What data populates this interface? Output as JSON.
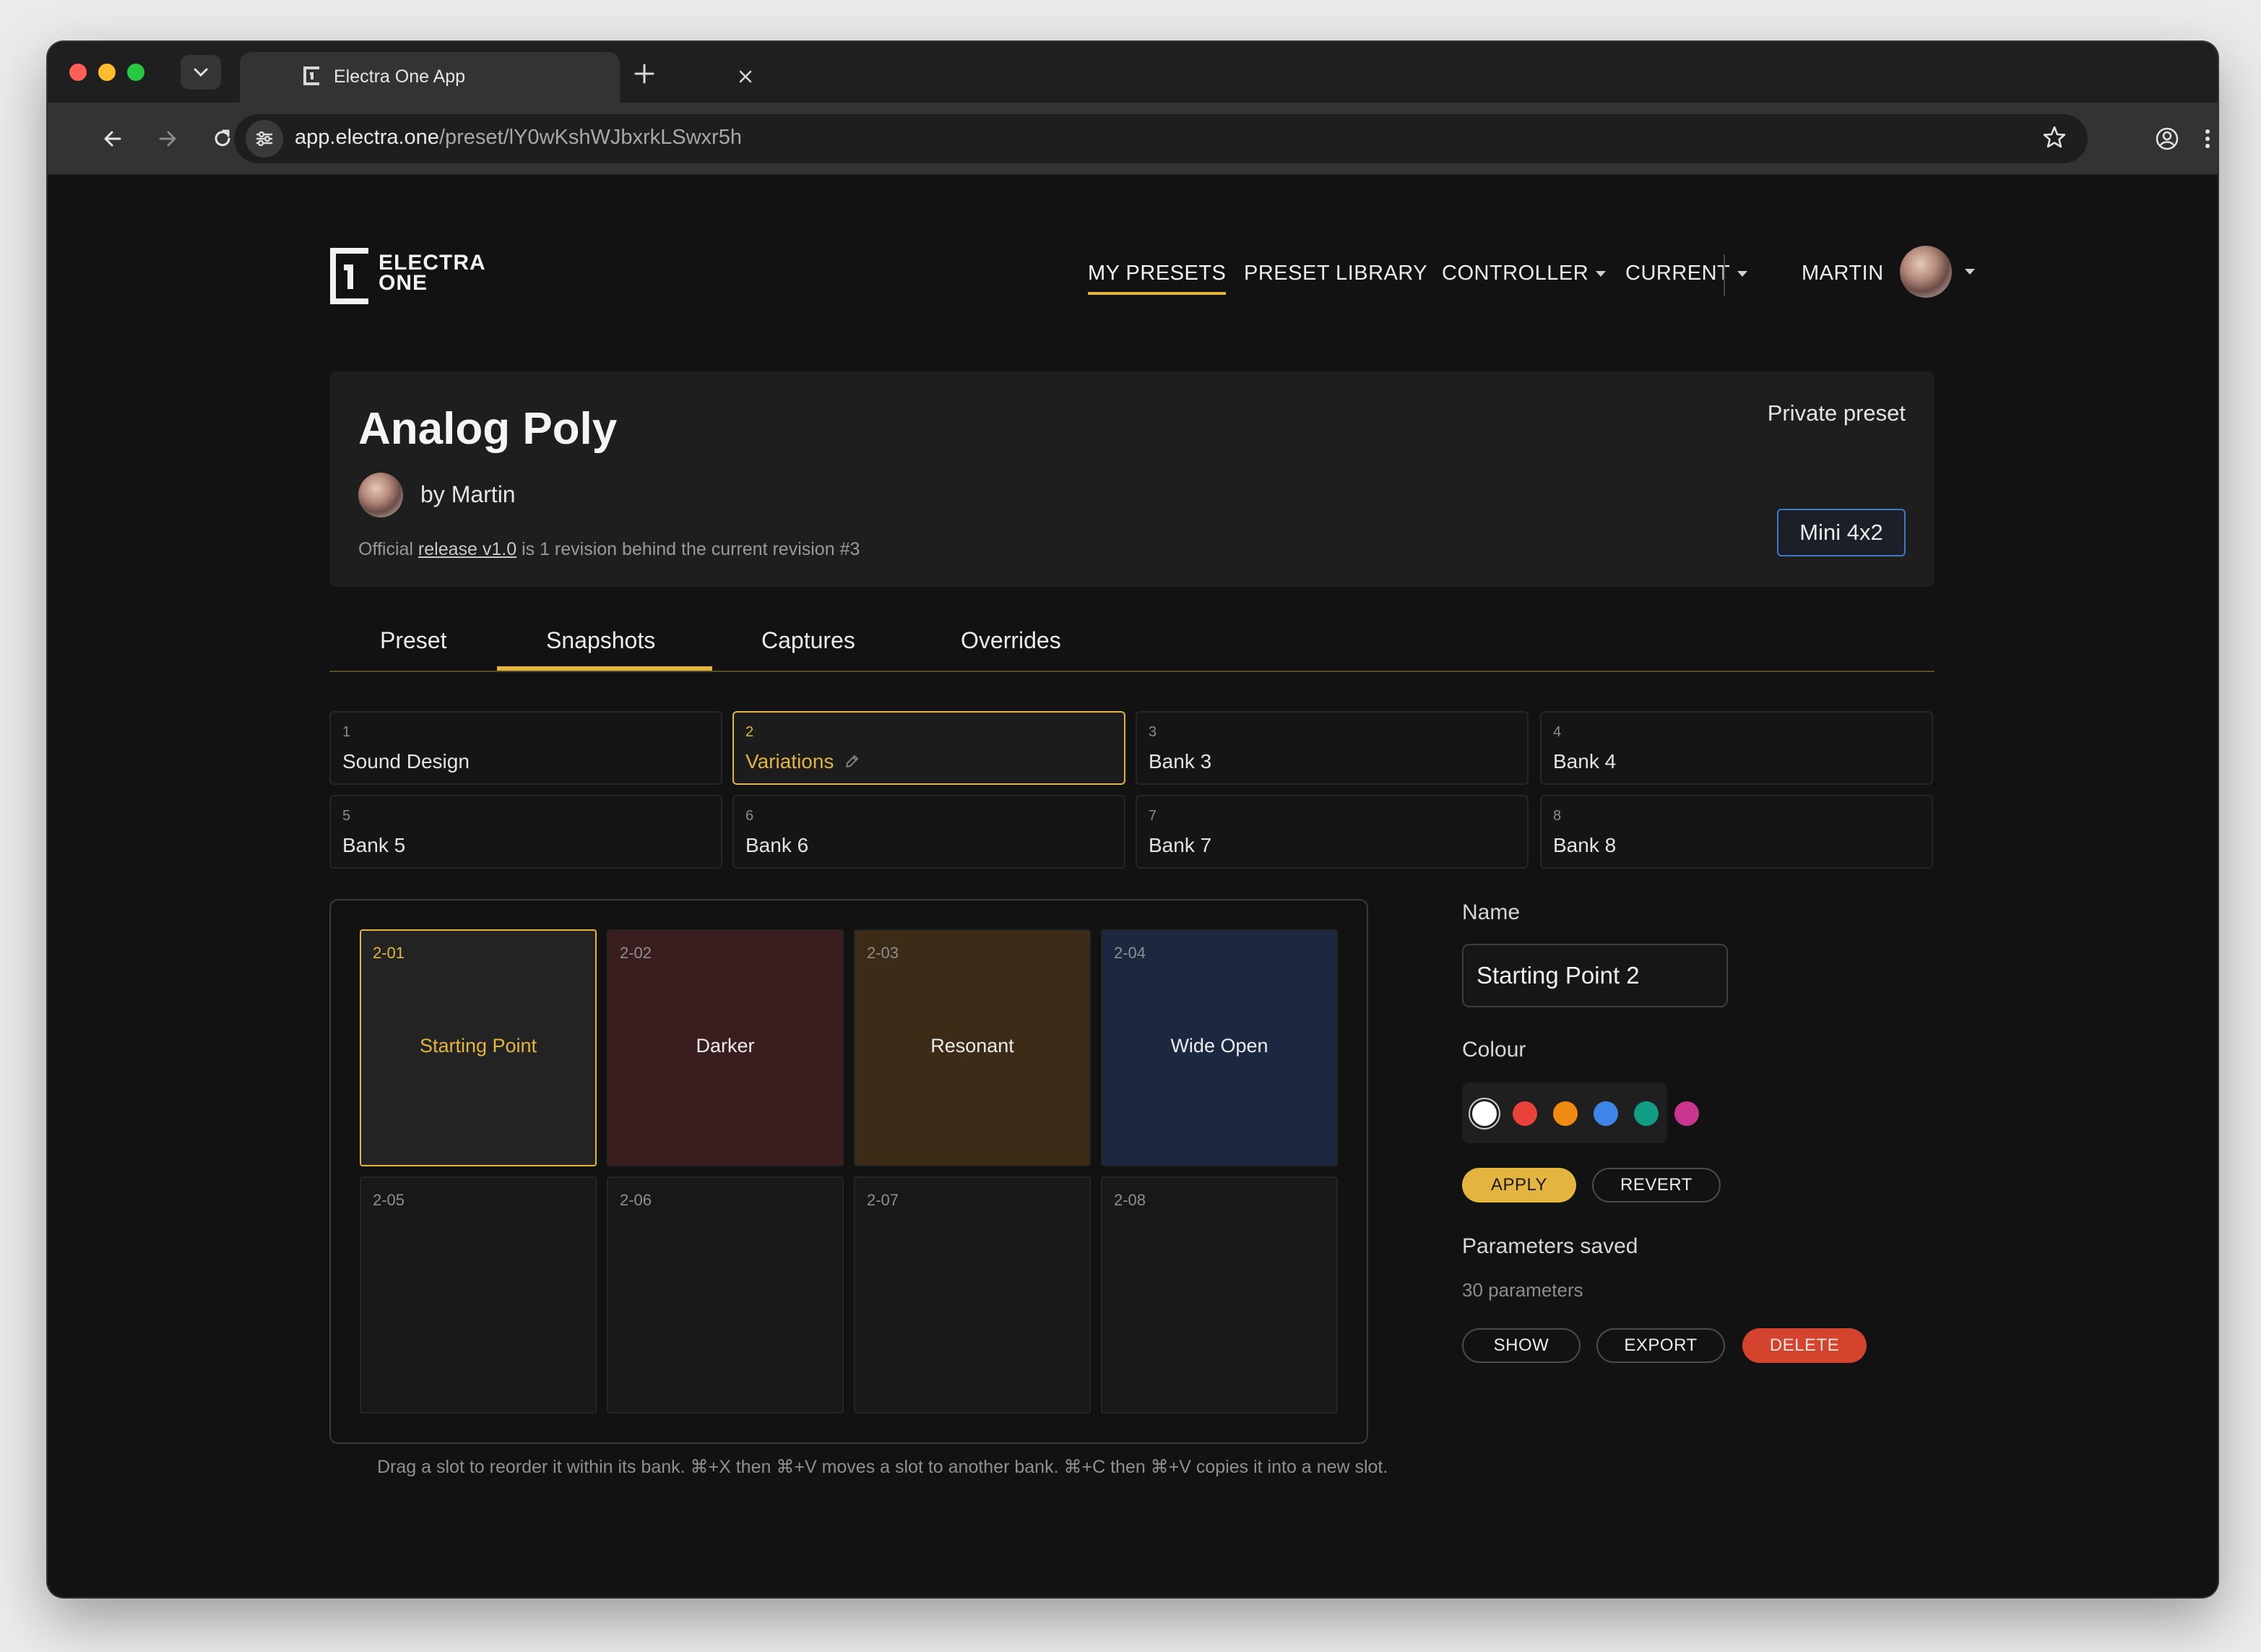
{
  "browser": {
    "tab_title": "Electra One App",
    "url_host": "app.electra.one",
    "url_path": "/preset/lY0wKshWJbxrkLSwxr5h"
  },
  "brand": {
    "line1": "ELECTRA",
    "line2": "ONE"
  },
  "nav": {
    "my_presets": "MY PRESETS",
    "preset_library": "PRESET LIBRARY",
    "controller": "CONTROLLER",
    "current": "CURRENT",
    "user": "MARTIN"
  },
  "preset": {
    "title": "Analog Poly",
    "author": "by Martin",
    "release_prefix": "Official",
    "release_link": "release v1.0",
    "release_suffix": "is 1 revision behind the current revision #3",
    "visibility": "Private preset",
    "device": "Mini 4x2"
  },
  "tabs": [
    "Preset",
    "Snapshots",
    "Captures",
    "Overrides"
  ],
  "banks": [
    {
      "num": "1",
      "name": "Sound Design"
    },
    {
      "num": "2",
      "name": "Variations"
    },
    {
      "num": "3",
      "name": "Bank 3"
    },
    {
      "num": "4",
      "name": "Bank 4"
    },
    {
      "num": "5",
      "name": "Bank 5"
    },
    {
      "num": "6",
      "name": "Bank 6"
    },
    {
      "num": "7",
      "name": "Bank 7"
    },
    {
      "num": "8",
      "name": "Bank 8"
    }
  ],
  "slots": [
    {
      "id": "2-01",
      "label": "Starting Point",
      "color": "#232323"
    },
    {
      "id": "2-02",
      "label": "Darker",
      "color": "#3a1e1f"
    },
    {
      "id": "2-03",
      "label": "Resonant",
      "color": "#3b2b17"
    },
    {
      "id": "2-04",
      "label": "Wide Open",
      "color": "#1c2840"
    },
    {
      "id": "2-05",
      "label": ""
    },
    {
      "id": "2-06",
      "label": ""
    },
    {
      "id": "2-07",
      "label": ""
    },
    {
      "id": "2-08",
      "label": ""
    }
  ],
  "hint": "Drag a slot to reorder it within its bank. ⌘+X then ⌘+V moves a slot to another bank. ⌘+C then ⌘+V copies it into a new slot.",
  "editor": {
    "name_label": "Name",
    "name_value": "Starting Point 2",
    "colour_label": "Colour",
    "colours": [
      "#ffffff",
      "#e8433a",
      "#f08a10",
      "#3d86e8",
      "#119c84",
      "#c8368f"
    ],
    "apply": "APPLY",
    "revert": "REVERT",
    "params_label": "Parameters saved",
    "params_count": "30 parameters",
    "show": "SHOW",
    "export": "EXPORT",
    "delete": "DELETE"
  }
}
